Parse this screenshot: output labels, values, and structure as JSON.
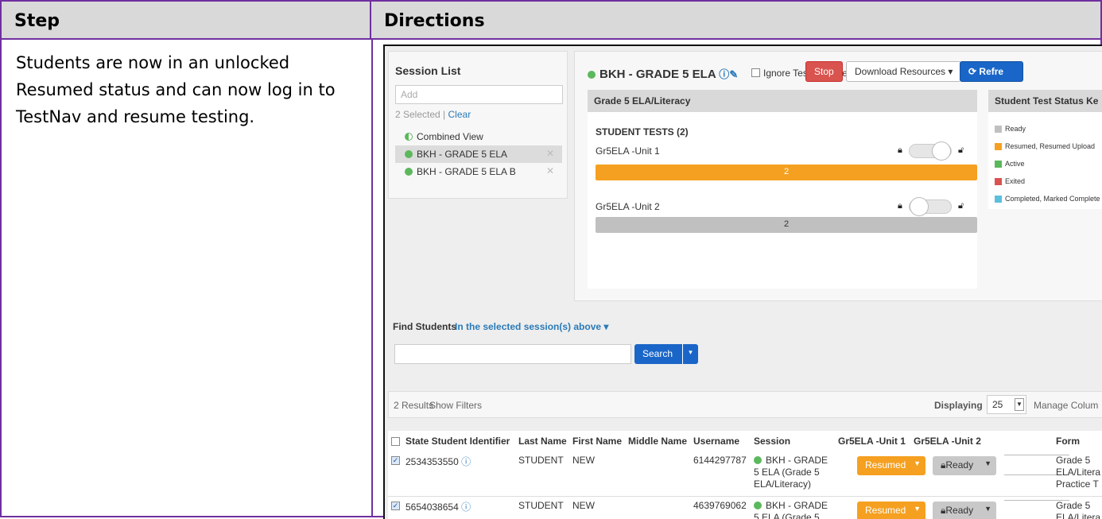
{
  "table": {
    "header_step": "Step",
    "header_directions": "Directions",
    "step_text": "Students are now in an unlocked Resumed status and can now log in to TestNav and resume testing."
  },
  "session_list": {
    "title": "Session List",
    "add_placeholder": "Add",
    "selected": "2 Selected |",
    "clear": "Clear",
    "items": [
      {
        "label": "Combined View"
      },
      {
        "label": "BKH - GRADE 5 ELA"
      },
      {
        "label": "BKH - GRADE 5 ELA B"
      }
    ],
    "remove_glyph": "✕"
  },
  "session": {
    "title": "BKH - GRADE 5 ELA",
    "ignore_label": "Ignore Testing Schedule",
    "stop_label": "Stop",
    "download_label": "Download Resources ▾",
    "refresh_label": "Refre",
    "grade_card_title": "Grade 5 ELA/Literacy",
    "student_tests_label": "STUDENT TESTS (2)",
    "units": [
      {
        "name": "Gr5ELA -Unit 1",
        "count": "2",
        "status_color": "#f5a020",
        "unlocked": true
      },
      {
        "name": "Gr5ELA -Unit 2",
        "count": "2",
        "status_color": "#c0c0c0",
        "unlocked": false
      }
    ],
    "key_title": "Student Test Status Ke",
    "key_items": [
      {
        "label": "Ready",
        "color": "#c0c0c0"
      },
      {
        "label": "Resumed, Resumed Upload",
        "color": "#f5a020"
      },
      {
        "label": "Active",
        "color": "#5cb85c"
      },
      {
        "label": "Exited",
        "color": "#d9534f"
      },
      {
        "label": "Completed, Marked Complete",
        "color": "#5bc0de"
      }
    ]
  },
  "find": {
    "label": "Find Students",
    "scope": "In the selected session(s) above ▾",
    "search_value": "",
    "search_button": "Search",
    "search_caret": "▾"
  },
  "results": {
    "count": "2 Results",
    "show_filters": "Show Filters",
    "displaying_label": "Displaying",
    "page_size": "25",
    "manage_columns": "Manage Colum"
  },
  "grid": {
    "headers": [
      "State Student Identifier",
      "Last Name",
      "First Name",
      "Middle Name",
      "Username",
      "Session",
      "Gr5ELA -Unit 1",
      "Gr5ELA -Unit 2",
      "Form"
    ],
    "rows": [
      {
        "id": "2534353550",
        "last": "STUDENT",
        "first": "NEW",
        "middle": "",
        "username": "6144297787",
        "session": "BKH - GRADE 5 ELA (Grade 5 ELA/Literacy)",
        "unit1": "Resumed",
        "unit2": "Ready",
        "form": "Grade 5 ELA/Litera Practice T"
      },
      {
        "id": "5654038654",
        "last": "STUDENT",
        "first": "NEW",
        "middle": "",
        "username": "4639769062",
        "session": "BKH - GRADE 5 ELA (Grade 5",
        "unit1": "Resumed",
        "unit2": "Ready",
        "form": "Grade 5 ELA/Litera"
      }
    ]
  }
}
